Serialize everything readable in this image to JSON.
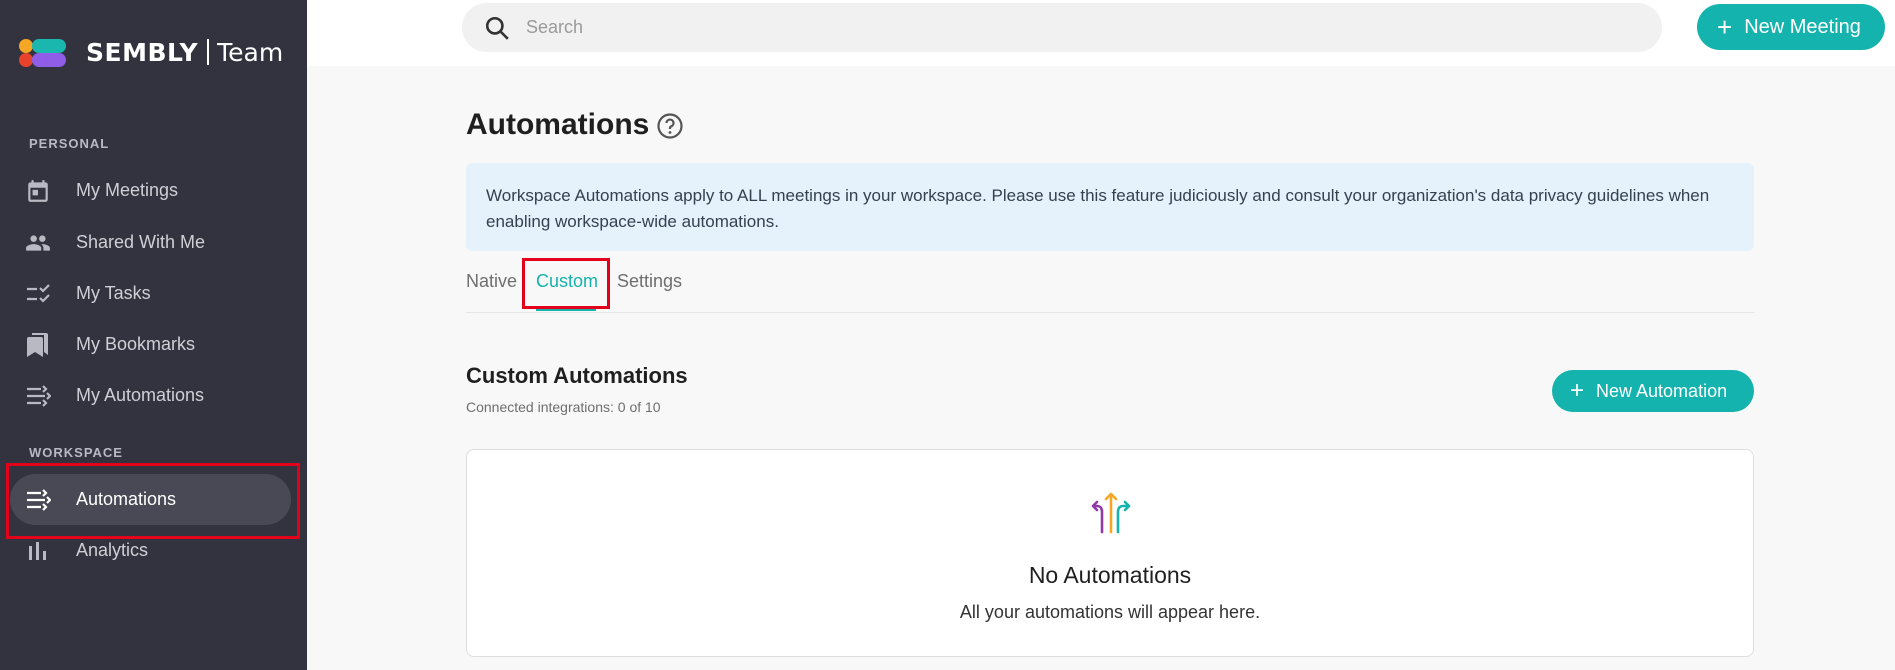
{
  "brand": {
    "name": "SEMBLY",
    "plan": "Team",
    "logo_colors": [
      "#f5a623",
      "#e8412c",
      "#1ab7ae",
      "#8f5de8"
    ]
  },
  "sidebar": {
    "personal_label": "PERSONAL",
    "workspace_label": "WORKSPACE",
    "personal_items": [
      {
        "label": "My Meetings",
        "icon": "calendar-icon"
      },
      {
        "label": "Shared With Me",
        "icon": "people-icon"
      },
      {
        "label": "My Tasks",
        "icon": "task-list-icon"
      },
      {
        "label": "My Bookmarks",
        "icon": "bookmark-icon"
      },
      {
        "label": "My Automations",
        "icon": "automation-icon"
      }
    ],
    "workspace_items": [
      {
        "label": "Automations",
        "icon": "automation-icon",
        "active": true
      },
      {
        "label": "Analytics",
        "icon": "bar-chart-icon"
      }
    ]
  },
  "topbar": {
    "search_placeholder": "Search",
    "new_meeting_label": "New Meeting"
  },
  "main": {
    "title": "Automations",
    "info_banner": "Workspace Automations apply to ALL meetings in your workspace. Please use this feature judiciously and consult your organization's data privacy guidelines when enabling workspace-wide automations.",
    "tabs": [
      {
        "label": "Native"
      },
      {
        "label": "Custom",
        "active": true
      },
      {
        "label": "Settings"
      }
    ],
    "section_title": "Custom Automations",
    "section_subtitle": "Connected integrations: 0 of 10",
    "new_automation_label": "New Automation",
    "empty_title": "No Automations",
    "empty_subtitle": "All your automations will appear here."
  },
  "colors": {
    "accent": "#14b3ad",
    "sidebar_bg": "#33333f",
    "highlight": "#e3001b"
  }
}
